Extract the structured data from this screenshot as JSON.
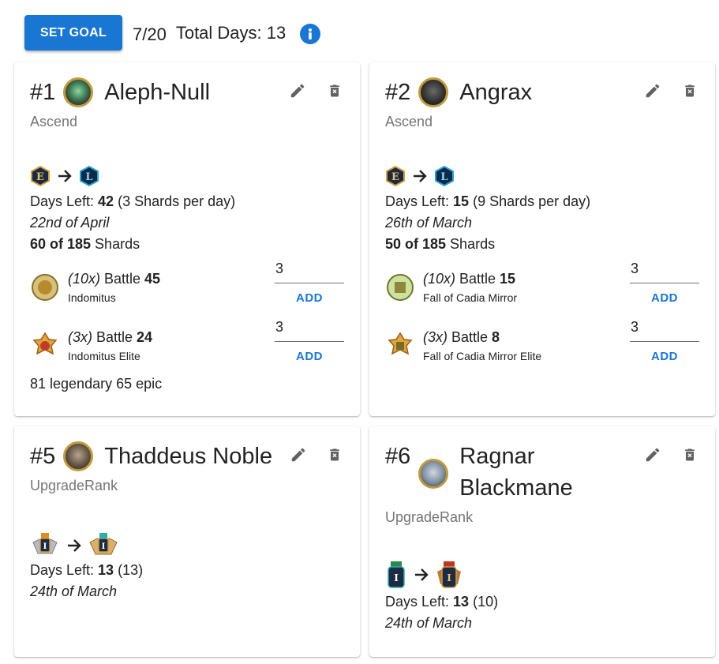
{
  "toolbar": {
    "set_goal_label": "SET GOAL",
    "goal_count": "7/20",
    "total_days": "Total Days: 13"
  },
  "cards": [
    {
      "number": "#1",
      "name": "Aleph-Null",
      "type": "Ascend",
      "from_rank": "E",
      "to_rank": "L",
      "days_left_label": "Days Left: ",
      "days_left": "42",
      "rate": " (3 Shards per day)",
      "date": "22nd of April",
      "shards_have": "60 of 185",
      "shards_word": " Shards",
      "battles": [
        {
          "multiplier": "(10x)",
          "label": " Battle ",
          "num": "45",
          "location": "Indomitus",
          "input": "3",
          "add": "ADD"
        },
        {
          "multiplier": "(3x)",
          "label": " Battle ",
          "num": "24",
          "location": "Indomitus Elite",
          "input": "3",
          "add": "ADD"
        }
      ],
      "footer": "81 legendary 65 epic"
    },
    {
      "number": "#2",
      "name": "Angrax",
      "type": "Ascend",
      "from_rank": "E",
      "to_rank": "L",
      "days_left_label": "Days Left: ",
      "days_left": "15",
      "rate": " (9 Shards per day)",
      "date": "26th of March",
      "shards_have": "50 of 185",
      "shards_word": " Shards",
      "battles": [
        {
          "multiplier": "(10x)",
          "label": " Battle ",
          "num": "15",
          "location": "Fall of Cadia Mirror",
          "input": "3",
          "add": "ADD"
        },
        {
          "multiplier": "(3x)",
          "label": " Battle ",
          "num": "8",
          "location": "Fall of Cadia Mirror Elite",
          "input": "3",
          "add": "ADD"
        }
      ]
    },
    {
      "number": "#5",
      "name": "Thaddeus Noble",
      "type": "UpgradeRank",
      "days_left_label": "Days Left: ",
      "days_left": "13",
      "rate": " (13)",
      "date": "24th of March"
    },
    {
      "number": "#6",
      "name_line1": "Ragnar",
      "name_line2": "Blackmane",
      "type": "UpgradeRank",
      "days_left_label": "Days Left: ",
      "days_left": "13",
      "rate": " (10)",
      "date": "24th of March"
    }
  ],
  "colors": {
    "accent": "#1976d2",
    "muted_text": "#757575",
    "gold": "#c29a3b"
  },
  "icons": [
    "info-icon",
    "edit-icon",
    "delete-icon",
    "arrow-right-icon"
  ]
}
